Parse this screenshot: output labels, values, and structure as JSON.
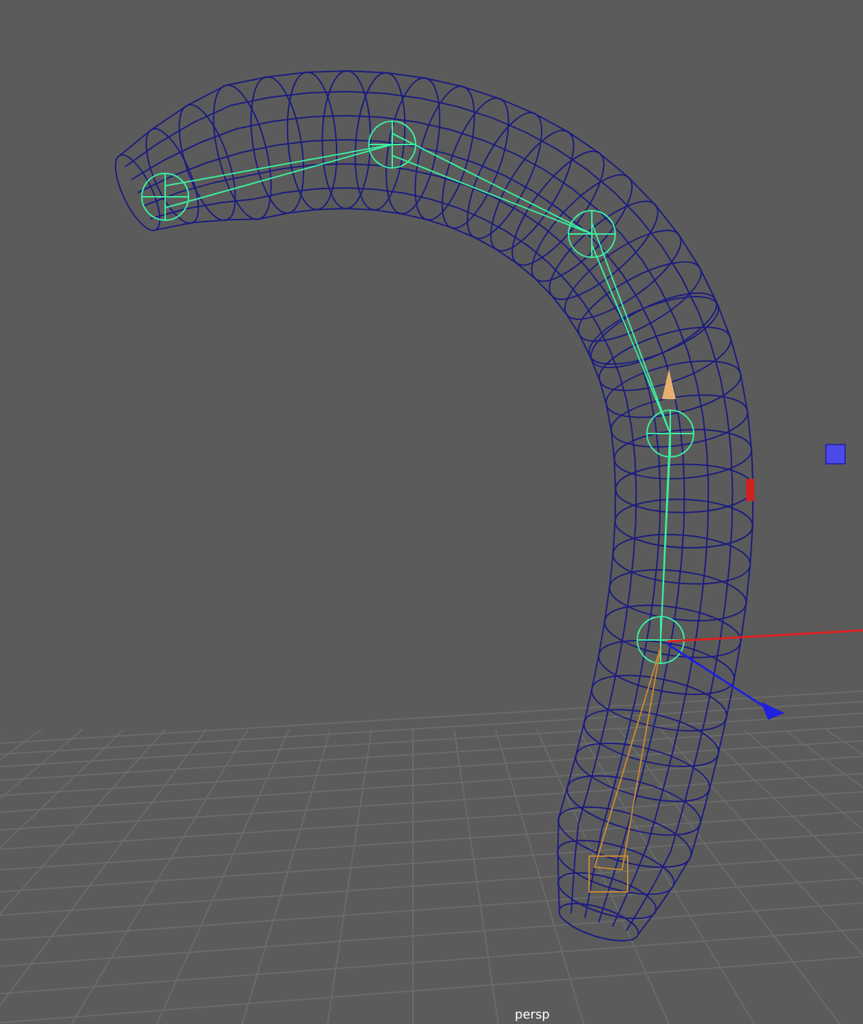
{
  "viewport": {
    "camera_label": "persp"
  }
}
